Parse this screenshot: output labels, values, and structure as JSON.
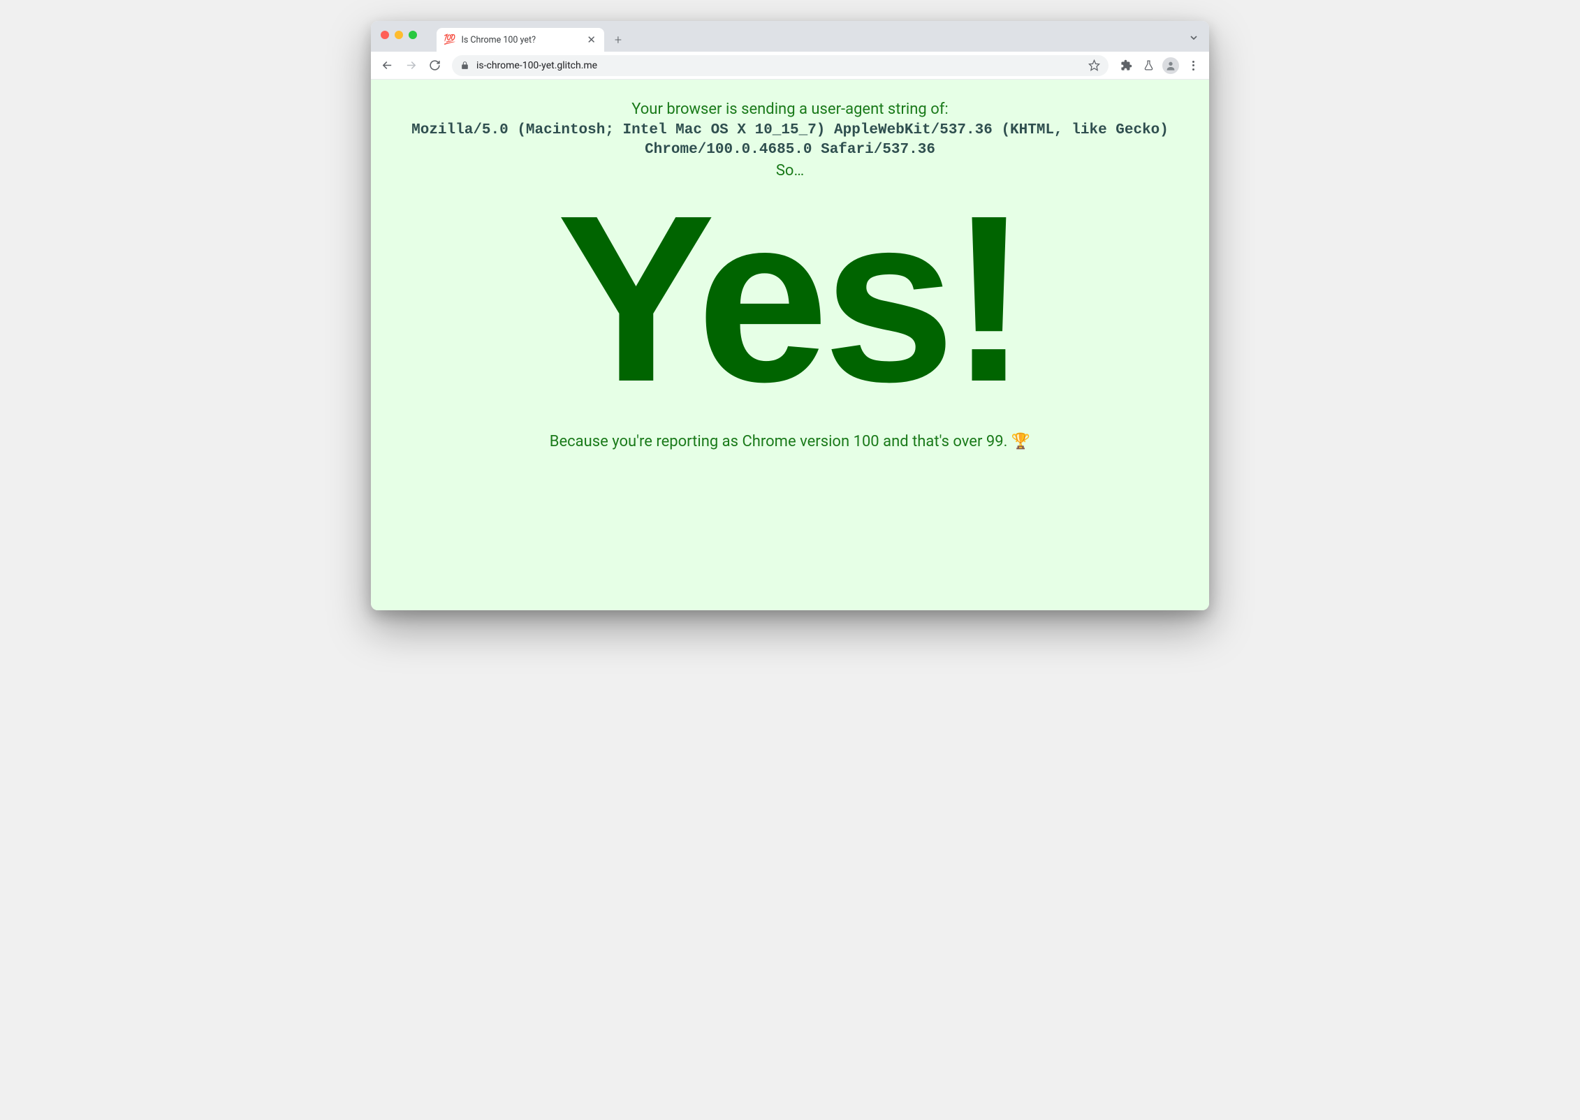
{
  "browser": {
    "tab": {
      "favicon": "💯",
      "title": "Is Chrome 100 yet?"
    },
    "url": "is-chrome-100-yet.glitch.me"
  },
  "page": {
    "intro": "Your browser is sending a user-agent string of:",
    "ua_string": "Mozilla/5.0 (Macintosh; Intel Mac OS X 10_15_7) AppleWebKit/537.36 (KHTML, like Gecko) Chrome/100.0.4685.0 Safari/537.36",
    "so": "So…",
    "answer": "Yes!",
    "explanation": "Because you're reporting as Chrome version 100 and that's over 99. 🏆"
  }
}
